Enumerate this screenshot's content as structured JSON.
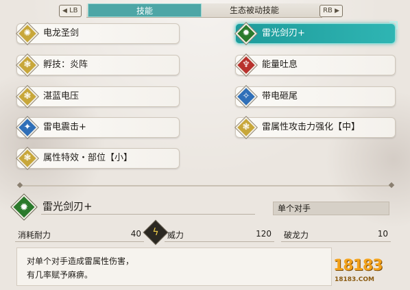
{
  "tabs": {
    "left_button": "LB",
    "right_button": "RB",
    "items": [
      "技能",
      "生态被动技能"
    ],
    "active_index": 0
  },
  "skills_left": [
    {
      "label": "电龙圣剑",
      "icon": "sword-skill-icon",
      "color": "#c8a73a"
    },
    {
      "label": "孵技：炎阵",
      "icon": "wirebug-skill-icon",
      "color": "#c8a73a"
    },
    {
      "label": "湛蓝电压",
      "icon": "wirebug-skill-icon",
      "color": "#c8a73a"
    },
    {
      "label": "雷电震击+",
      "icon": "thunder-strike-icon",
      "color": "#2f6fb8"
    },
    {
      "label": "属性特效・部位【小】",
      "icon": "wirebug-skill-icon",
      "color": "#c8a73a"
    }
  ],
  "skills_right": [
    {
      "label": "雷光剑刃+",
      "icon": "lightning-blade-icon",
      "color": "#2b7a2c",
      "selected": true
    },
    {
      "label": "能量吐息",
      "icon": "breath-skill-icon",
      "color": "#b8322d"
    },
    {
      "label": "带电砸尾",
      "icon": "tail-slam-icon",
      "color": "#2f6fb8"
    },
    {
      "label": "雷属性攻击力强化【中】",
      "icon": "wirebug-skill-icon",
      "color": "#c8a73a"
    }
  ],
  "detail": {
    "title": "雷光剑刃+",
    "icon": "lightning-blade-icon",
    "icon_color": "#2b7a2c",
    "target": "单个对手",
    "stats": [
      {
        "label": "消耗耐力",
        "value": "40"
      },
      {
        "label": "威力",
        "value": "120"
      },
      {
        "label": "破龙力",
        "value": "10"
      }
    ],
    "description": [
      "对单个对手造成雷属性伤害，",
      "有几率赋予麻痹。"
    ]
  },
  "watermark": {
    "text": "18183",
    "caption": "18183.COM"
  },
  "colors": {
    "accent": "#2fb5b3",
    "panel": "#f4f1ec"
  }
}
